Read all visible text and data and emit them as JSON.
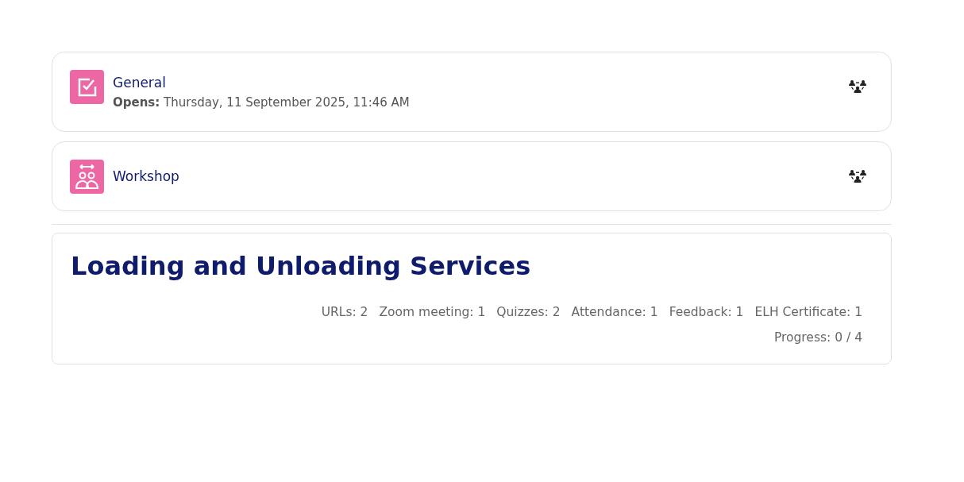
{
  "activities": [
    {
      "kind": "quiz",
      "name": "General",
      "dates": "**Opens:** Thursday, 11 September 2025, 11:46 AM"
    },
    {
      "kind": "workshop",
      "name": "Workshop"
    }
  ],
  "section": {
    "title": "Loading and Unloading Services",
    "counts": [
      "URLs: 2",
      "Zoom meeting: 1",
      "Quizzes: 2",
      "Attendance: 1",
      "Feedback: 1",
      "ELH Certificate: 1"
    ],
    "progress": "Progress: 0 / 4"
  }
}
